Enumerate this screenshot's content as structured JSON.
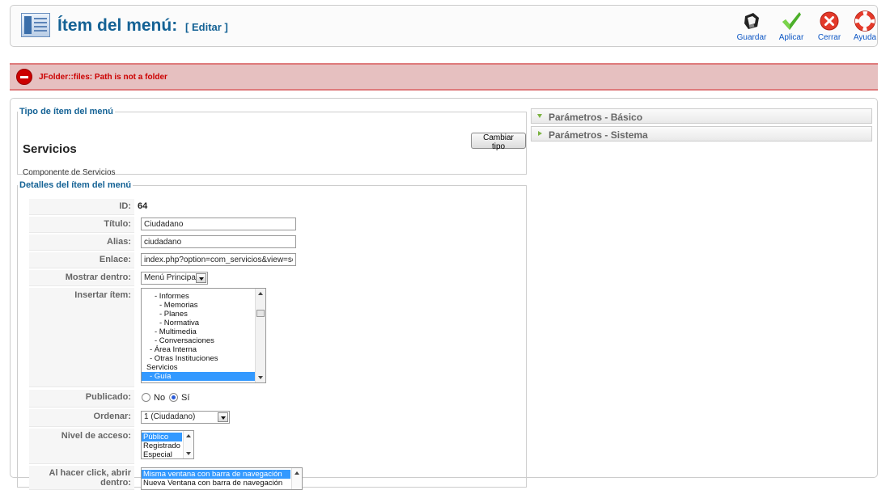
{
  "header": {
    "title": "Ítem del menú:",
    "subtitle": "[ Editar ]",
    "buttons": [
      {
        "label": "Guardar",
        "icon": "floppy-icon"
      },
      {
        "label": "Aplicar",
        "icon": "checkmark-icon"
      },
      {
        "label": "Cerrar",
        "icon": "close-icon"
      },
      {
        "label": "Ayuda",
        "icon": "lifebuoy-icon"
      }
    ]
  },
  "error": {
    "message": "JFolder::files: Path is not a folder"
  },
  "type_section": {
    "legend": "Tipo de ítem del menú",
    "name": "Servicios",
    "component": "Componente de Servicios",
    "change_button": "Cambiar tipo"
  },
  "details": {
    "legend": "Detalles del ítem del menú",
    "id_label": "ID:",
    "id_value": "64",
    "title_label": "Título:",
    "title_value": "Ciudadano",
    "alias_label": "Alias:",
    "alias_value": "ciudadano",
    "link_label": "Enlace:",
    "link_value": "index.php?option=com_servicios&view=servicios",
    "show_in_label": "Mostrar dentro:",
    "show_in_value": "Menú Principal",
    "insert_label": "Insertar ítem:",
    "insert_items": [
      "- Informes",
      "- Memorias",
      "- Planes",
      "- Normativa",
      "- Multimedia",
      "- Conversaciones",
      "- Área Interna",
      "- Otras Instituciones",
      "Servicios",
      "- Guía"
    ],
    "published_label": "Publicado:",
    "published_no": "No",
    "published_yes": "Sí",
    "order_label": "Ordenar:",
    "order_value": "1 (Ciudadano)",
    "access_label": "Nivel de acceso:",
    "access_options": [
      "Público",
      "Registrado",
      "Especial"
    ],
    "click_label": "Al hacer click, abrir dentro:",
    "click_options": [
      "Misma ventana con barra de navegación",
      "Nueva Ventana con barra de navegación"
    ]
  },
  "panes": {
    "basic": "Parámetros - Básico",
    "system": "Parámetros - Sistema"
  },
  "colors": {
    "title_blue": "#146295",
    "link_blue": "#0b55c4",
    "error_red": "#cc0000",
    "error_bg": "#e6c0c0",
    "selection_blue": "#3399ff"
  }
}
